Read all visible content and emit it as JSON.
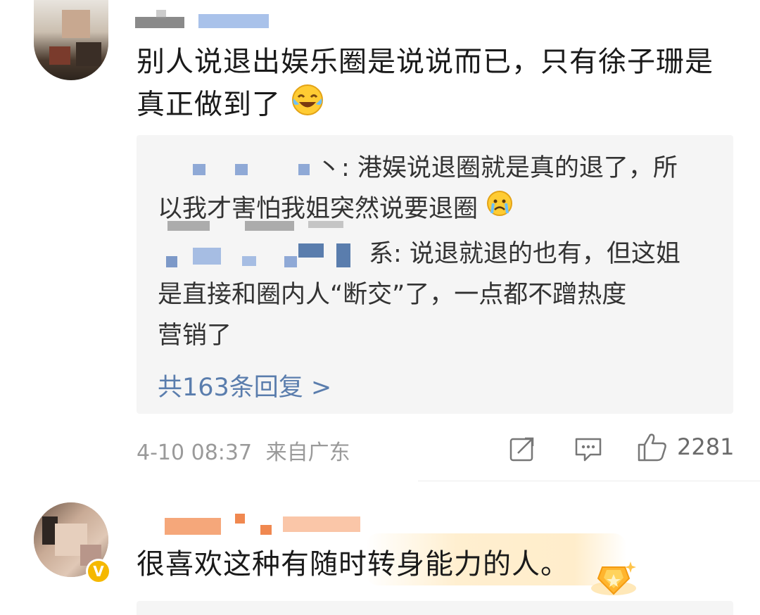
{
  "comment1": {
    "avatar": "avatar-icon",
    "text_line1": "别人说退出娱乐圈是说说而已，只有徐子珊是",
    "text_line2": "真正做到了",
    "emoji": "laugh-cry-emoji",
    "replies": [
      {
        "text_line1": "丶: 港娱说退圈就是真的退了，所",
        "text_line2": "以我才害怕我姐突然说要退圈",
        "emoji": "crying-emoji"
      },
      {
        "text_line1": "系: 说退就退的也有，但这姐",
        "text_line2": "是直接和圈内人“断交”了，一点都不蹭热度",
        "text_line3": "营销了"
      }
    ],
    "more_replies": "共163条回复 >",
    "timestamp": "4-10 08:37",
    "location": "来自广东",
    "like_count": "2281"
  },
  "comment2": {
    "avatar": "avatar-icon",
    "verified_badge": "V",
    "text": "很喜欢这种有随时转身能力的人。",
    "badge_icon": "fan-badge-icon"
  },
  "colors": {
    "link": "#5a7dad",
    "meta": "#9a9a9a",
    "reply_bg": "#f5f5f5",
    "badge": "#f5b800"
  }
}
